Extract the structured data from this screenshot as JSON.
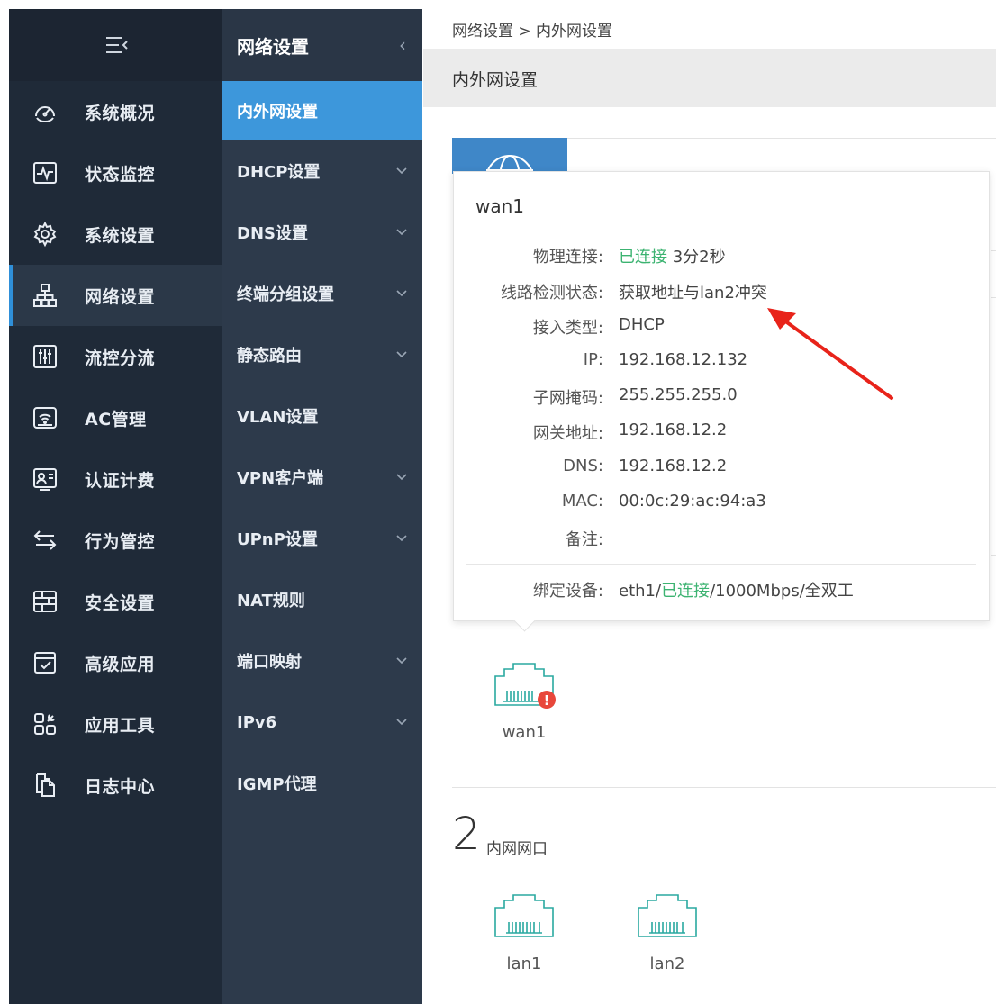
{
  "sidebar": {
    "items": [
      {
        "label": "系统概况",
        "icon": "dashboard-icon"
      },
      {
        "label": "状态监控",
        "icon": "monitor-icon"
      },
      {
        "label": "系统设置",
        "icon": "gear-icon"
      },
      {
        "label": "网络设置",
        "icon": "network-icon",
        "active": true
      },
      {
        "label": "流控分流",
        "icon": "sliders-icon"
      },
      {
        "label": "AC管理",
        "icon": "wifi-router-icon"
      },
      {
        "label": "认证计费",
        "icon": "id-card-icon"
      },
      {
        "label": "行为管控",
        "icon": "swap-arrows-icon"
      },
      {
        "label": "安全设置",
        "icon": "firewall-icon"
      },
      {
        "label": "高级应用",
        "icon": "checklist-icon"
      },
      {
        "label": "应用工具",
        "icon": "tools-grid-icon"
      },
      {
        "label": "日志中心",
        "icon": "document-icon"
      }
    ]
  },
  "subnav": {
    "title": "网络设置",
    "items": [
      {
        "label": "内外网设置",
        "active": true,
        "has_arrow": false
      },
      {
        "label": "DHCP设置",
        "has_arrow": true
      },
      {
        "label": "DNS设置",
        "has_arrow": true
      },
      {
        "label": "终端分组设置",
        "has_arrow": true
      },
      {
        "label": "静态路由",
        "has_arrow": true
      },
      {
        "label": "VLAN设置",
        "has_arrow": false
      },
      {
        "label": "VPN客户端",
        "has_arrow": true
      },
      {
        "label": "UPnP设置",
        "has_arrow": true
      },
      {
        "label": "NAT规则",
        "has_arrow": false
      },
      {
        "label": "端口映射",
        "has_arrow": true
      },
      {
        "label": "IPv6",
        "has_arrow": true
      },
      {
        "label": "IGMP代理",
        "has_arrow": false
      }
    ]
  },
  "main": {
    "breadcrumb": "网络设置 > 内外网设置",
    "page_title": "内外网设置",
    "popup": {
      "title": "wan1",
      "physical": {
        "key": "物理连接:",
        "status": "已连接",
        "duration": " 3分2秒"
      },
      "line_check": {
        "key": "线路检测状态:",
        "value": "获取地址与lan2冲突"
      },
      "access_type": {
        "key": "接入类型:",
        "value": "DHCP"
      },
      "ip": {
        "key": "IP:",
        "value": "192.168.12.132"
      },
      "mask": {
        "key": "子网掩码:",
        "value": "255.255.255.0"
      },
      "gateway": {
        "key": "网关地址:",
        "value": "192.168.12.2"
      },
      "dns": {
        "key": "DNS:",
        "value": "192.168.12.2"
      },
      "mac": {
        "key": "MAC:",
        "value": "00:0c:29:ac:94:a3"
      },
      "note": {
        "key": "备注:",
        "value": ""
      },
      "bind": {
        "key": "绑定设备:",
        "pre": "eth1/",
        "status": "已连接",
        "post": "/1000Mbps/全双工"
      }
    },
    "wan_port": {
      "label": "wan1"
    },
    "lan_section": {
      "count": "2",
      "title": "内网网口"
    },
    "lan_ports": [
      {
        "label": "lan1"
      },
      {
        "label": "lan2"
      }
    ]
  },
  "colors": {
    "accent": "#3d97db",
    "ok": "#3cb371",
    "error": "#e8473b",
    "sidebar": "#1f2a38"
  }
}
